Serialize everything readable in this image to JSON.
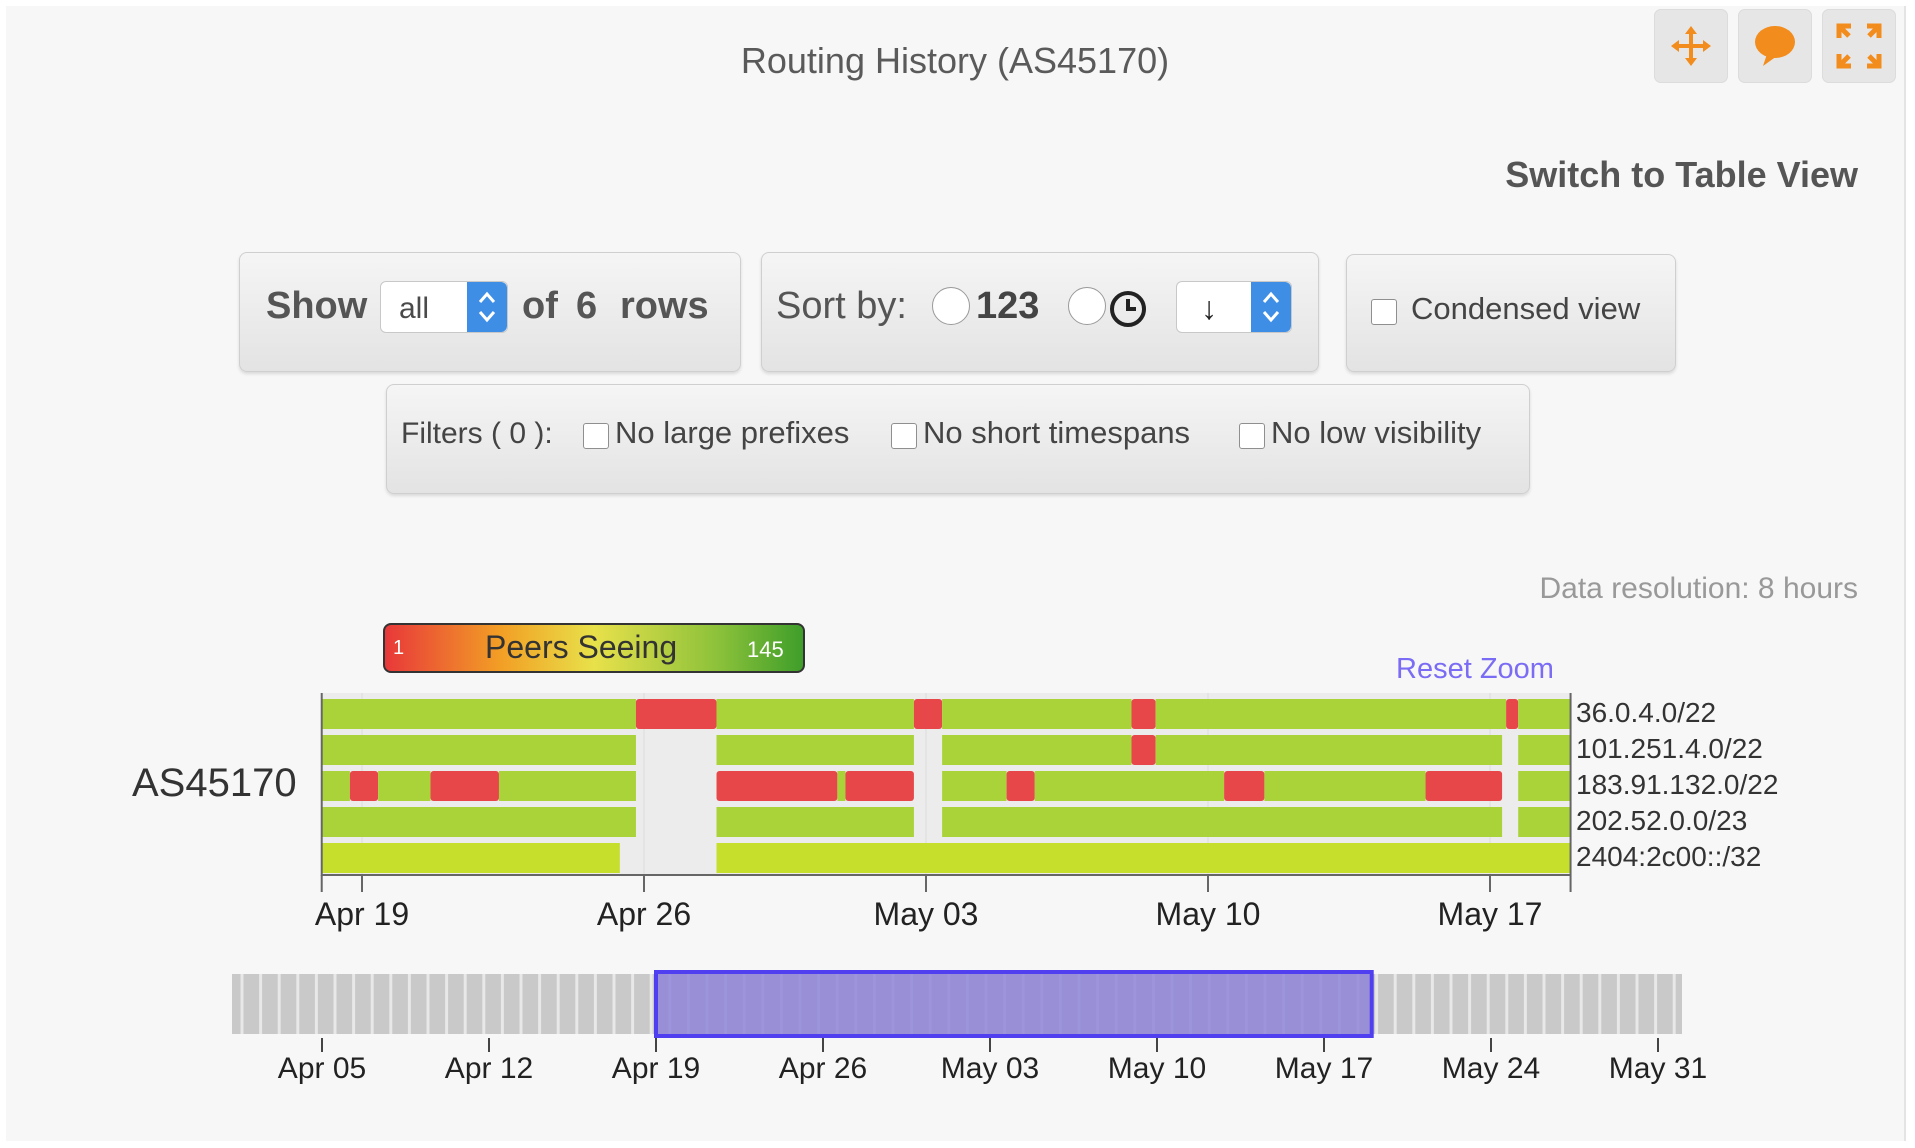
{
  "title": "Routing History (AS45170)",
  "toolbar_icons": [
    "move-icon",
    "comment-icon",
    "fullscreen-icon"
  ],
  "switch_view": "Switch to Table View",
  "show": {
    "label": "Show",
    "value": "all",
    "of_text": "of",
    "count": "6",
    "rows_text": "rows"
  },
  "sort": {
    "label": "Sort by:",
    "option_numeric": "123",
    "option_time": "clock-icon",
    "direction": "↓"
  },
  "condensed": "Condensed view",
  "filters": {
    "label": "Filters ( 0 ):",
    "options": [
      "No large prefixes",
      "No short timespans",
      "No low visibility"
    ]
  },
  "data_resolution": "Data resolution: 8 hours",
  "legend": {
    "label": "Peers Seeing",
    "min": "1",
    "max": "145"
  },
  "reset_zoom": "Reset Zoom",
  "colors": {
    "full": "#a9d339",
    "low": "#e8474a",
    "mid": "#c6de2c",
    "nav": "#8f85d8",
    "accent": "#f28c1c"
  },
  "chart_data": {
    "type": "timeline",
    "asn": "AS45170",
    "x_range": [
      "Apr 18",
      "May 19"
    ],
    "x_ticks": [
      "Apr 19",
      "Apr 26",
      "May 03",
      "May 10",
      "May 17"
    ],
    "rows": [
      {
        "prefix": "36.0.4.0/22",
        "segments": [
          {
            "start": "Apr 18",
            "end": "Apr 25.8",
            "level": "full"
          },
          {
            "start": "Apr 25.8",
            "end": "Apr 27.8",
            "level": "low"
          },
          {
            "start": "Apr 27.8",
            "end": "May 02.7",
            "level": "full"
          },
          {
            "start": "May 02.7",
            "end": "May 03.4",
            "level": "low"
          },
          {
            "start": "May 03.4",
            "end": "May 08.1",
            "level": "full"
          },
          {
            "start": "May 08.1",
            "end": "May 08.7",
            "level": "low"
          },
          {
            "start": "May 08.7",
            "end": "May 17.4",
            "level": "full"
          },
          {
            "start": "May 17.4",
            "end": "May 17.7",
            "level": "low"
          },
          {
            "start": "May 17.7",
            "end": "May 19",
            "level": "full"
          }
        ]
      },
      {
        "prefix": "101.251.4.0/22",
        "segments": [
          {
            "start": "Apr 18",
            "end": "Apr 25.8",
            "level": "full"
          },
          {
            "start": "Apr 27.8",
            "end": "May 02.7",
            "level": "full"
          },
          {
            "start": "May 03.4",
            "end": "May 08.1",
            "level": "full"
          },
          {
            "start": "May 08.1",
            "end": "May 08.7",
            "level": "low"
          },
          {
            "start": "May 08.7",
            "end": "May 17.3",
            "level": "full"
          },
          {
            "start": "May 17.7",
            "end": "May 19",
            "level": "full"
          }
        ]
      },
      {
        "prefix": "183.91.132.0/22",
        "segments": [
          {
            "start": "Apr 18",
            "end": "Apr 18.7",
            "level": "full"
          },
          {
            "start": "Apr 18.7",
            "end": "Apr 19.4",
            "level": "low"
          },
          {
            "start": "Apr 19.4",
            "end": "Apr 20.7",
            "level": "full"
          },
          {
            "start": "Apr 20.7",
            "end": "Apr 22.4",
            "level": "low"
          },
          {
            "start": "Apr 22.4",
            "end": "Apr 25.8",
            "level": "full"
          },
          {
            "start": "Apr 27.8",
            "end": "Apr 30.8",
            "level": "low"
          },
          {
            "start": "Apr 30.8",
            "end": "Apr 31.0",
            "level": "full"
          },
          {
            "start": "Apr 31.0",
            "end": "May 02.7",
            "level": "low"
          },
          {
            "start": "May 03.4",
            "end": "May 05.0",
            "level": "full"
          },
          {
            "start": "May 05.0",
            "end": "May 05.7",
            "level": "low"
          },
          {
            "start": "May 05.7",
            "end": "May 10.4",
            "level": "full"
          },
          {
            "start": "May 10.4",
            "end": "May 11.4",
            "level": "low"
          },
          {
            "start": "May 11.4",
            "end": "May 15.4",
            "level": "full"
          },
          {
            "start": "May 15.4",
            "end": "May 17.3",
            "level": "low"
          },
          {
            "start": "May 17.7",
            "end": "May 19",
            "level": "full"
          }
        ]
      },
      {
        "prefix": "202.52.0.0/23",
        "segments": [
          {
            "start": "Apr 18",
            "end": "Apr 25.8",
            "level": "full"
          },
          {
            "start": "Apr 27.8",
            "end": "May 02.7",
            "level": "full"
          },
          {
            "start": "May 03.4",
            "end": "May 17.3",
            "level": "full"
          },
          {
            "start": "May 17.7",
            "end": "May 19",
            "level": "full"
          }
        ]
      },
      {
        "prefix": "2404:2c00::/32",
        "segments": [
          {
            "start": "Apr 18",
            "end": "Apr 25.4",
            "level": "mid"
          },
          {
            "start": "Apr 27.8",
            "end": "May 19",
            "level": "mid"
          }
        ]
      }
    ],
    "navigator": {
      "ticks": [
        "Apr 05",
        "Apr 12",
        "Apr 19",
        "Apr 26",
        "May 03",
        "May 10",
        "May 17",
        "May 24",
        "May 31"
      ],
      "selection": [
        "Apr 19",
        "May 19"
      ]
    }
  }
}
